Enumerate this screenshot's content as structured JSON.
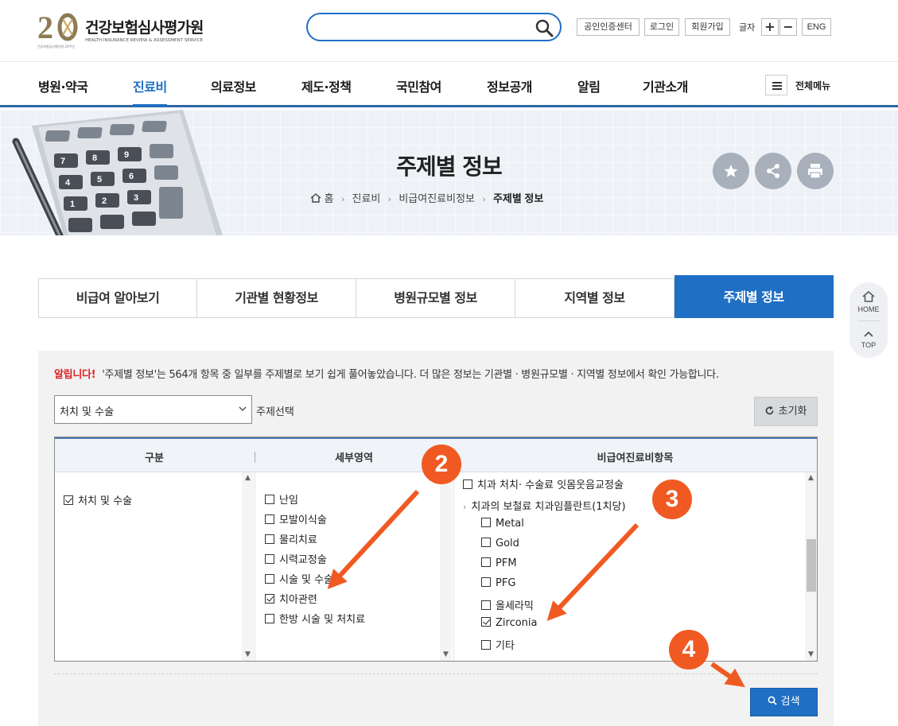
{
  "header": {
    "logo_name": "건강보험심사평가원",
    "logo_sub": "HEALTH INSURANCE REVIEW & ASSESSMENT SERVICE",
    "logo_sub_left": "건강보험심사평가원 20주년",
    "search_placeholder": "",
    "utils": {
      "cert": "공인인증센터",
      "login": "로그인",
      "join": "회원가입",
      "font_label": "글자",
      "font_plus": "+",
      "font_minus": "−",
      "lang": "ENG"
    }
  },
  "gnb": {
    "items": [
      "병원·약국",
      "진료비",
      "의료정보",
      "제도·정책",
      "국민참여",
      "정보공개",
      "알림",
      "기관소개"
    ],
    "active_index": 1,
    "all_menu": "전체메뉴"
  },
  "banner": {
    "title": "주제별 정보",
    "breadcrumb": [
      "홈",
      "진료비",
      "비급여진료비정보",
      "주제별 정보"
    ]
  },
  "side": {
    "home": "HOME",
    "top": "TOP"
  },
  "tabs": [
    "비급여 알아보기",
    "기관별 현황정보",
    "병원규모별 정보",
    "지역별 정보",
    "주제별 정보"
  ],
  "notice": {
    "alert": "알립니다!",
    "text": "'주제별 정보'는 564개 항목 중 일부를 주제별로 보기 쉽게 풀어놓았습니다. 더 많은 정보는 기관별 · 병원규모별 · 지역별 정보에서 확인 가능합니다."
  },
  "filter": {
    "select_value": "처치 및 수술",
    "select_label": "주제선택",
    "reset": "초기화"
  },
  "grid": {
    "headers": [
      "구분",
      "세부영역",
      "비급여진료비항목"
    ],
    "col1": [
      {
        "label": "처치 및 수술",
        "checked": true
      }
    ],
    "col2": [
      {
        "label": "난임",
        "checked": false
      },
      {
        "label": "모발이식술",
        "checked": false
      },
      {
        "label": "물리치료",
        "checked": false
      },
      {
        "label": "시력교정술",
        "checked": false
      },
      {
        "label": "시술 및 수술",
        "checked": false
      },
      {
        "label": "치아관련",
        "checked": true
      },
      {
        "label": "한방 시술 및 처치료",
        "checked": false
      }
    ],
    "col3_top": {
      "label": "치과 처치· 수술료 잇몸웃음교정술",
      "checked": false
    },
    "col3_group": "치과의 보철료 치과임플란트(1치당)",
    "col3": [
      {
        "label": "Metal",
        "checked": false
      },
      {
        "label": "Gold",
        "checked": false
      },
      {
        "label": "PFM",
        "checked": false
      },
      {
        "label": "PFG",
        "checked": false
      },
      {
        "label": "올세라믹",
        "checked": false
      },
      {
        "label": "Zirconia",
        "checked": true
      },
      {
        "label": "기타",
        "checked": false
      }
    ]
  },
  "search_button": "검색",
  "annotations": {
    "badges": [
      "2",
      "3",
      "4"
    ],
    "color": "#f05a22"
  },
  "colors": {
    "primary": "#1f6fc4",
    "alert": "#e02020",
    "annotation": "#f05a22"
  }
}
